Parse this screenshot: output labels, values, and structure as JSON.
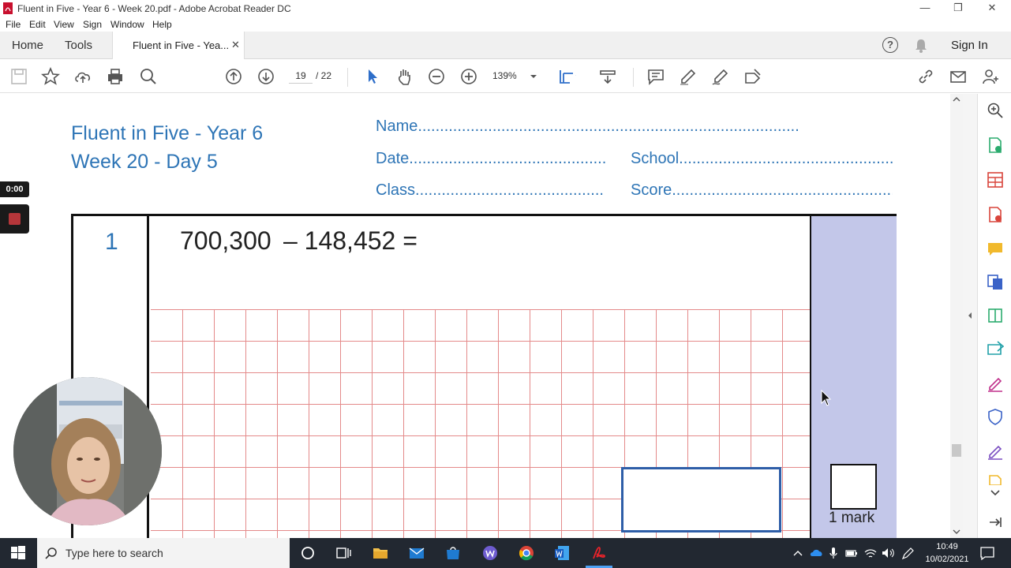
{
  "window": {
    "title": "Fluent in Five - Year 6 - Week 20.pdf - Adobe Acrobat Reader DC"
  },
  "menu": [
    "File",
    "Edit",
    "View",
    "Sign",
    "Window",
    "Help"
  ],
  "tabs": {
    "home": "Home",
    "tools": "Tools",
    "document": "Fluent in Five - Yea...",
    "close": "✕",
    "signin": "Sign In",
    "help": "?"
  },
  "toolbar": {
    "page_current": "19",
    "page_total": "/ 22",
    "zoom": "139%"
  },
  "worksheet": {
    "title_line1": "Fluent in Five - Year 6",
    "title_line2": "Week 20 - Day 5",
    "name_field": "Name.......................................................................................",
    "date_field": "Date.............................................",
    "school_field": "School..............................................................",
    "class_field": "Class...........................................",
    "score_field": "Score..............................................................",
    "question_number": "1",
    "question_text": "700,300  – 148,452 =",
    "mark_label": "1 mark"
  },
  "recording": {
    "timer": "0:00"
  },
  "taskbar": {
    "search_placeholder": "Type here to search",
    "time": "10:49",
    "date": "10/02/2021"
  },
  "colors": {
    "accent": "#2e75b6",
    "mark_column": "#c3c7e9",
    "grid_line": "#e48a8a",
    "answer_box": "#2e5ea8",
    "taskbar": "#222831"
  }
}
